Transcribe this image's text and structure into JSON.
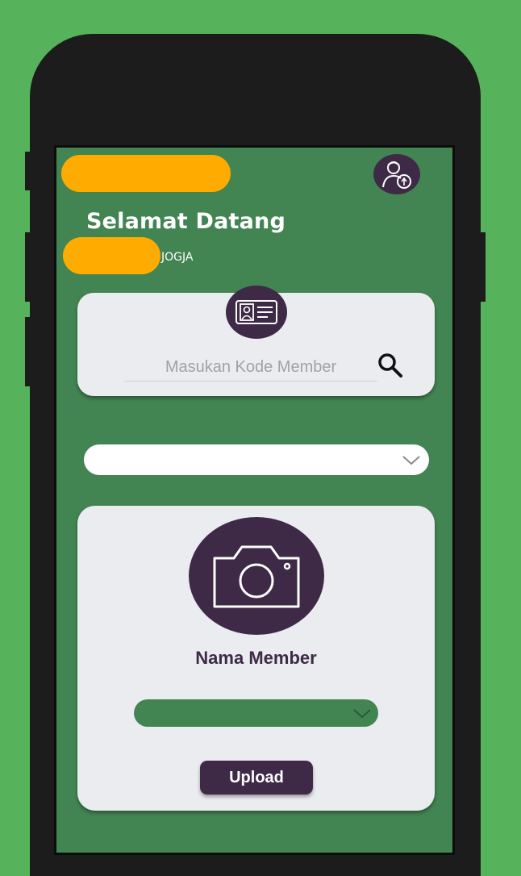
{
  "header": {
    "welcome_text": "Selamat Datang",
    "city_text": "JOGJA"
  },
  "search": {
    "placeholder": "Masukan Kode Member",
    "value": ""
  },
  "member": {
    "name_label": "Nama Member",
    "upload_label": "Upload"
  },
  "icons": [
    "profile-icon",
    "id-card-icon",
    "search-icon",
    "chevron-down-icon",
    "camera-icon",
    "chevron-down-icon"
  ],
  "colors": {
    "background": "#57b25c",
    "screen": "#428552",
    "accent": "#3e2a47",
    "card": "#ebecf0",
    "redaction": "#ffab00"
  }
}
